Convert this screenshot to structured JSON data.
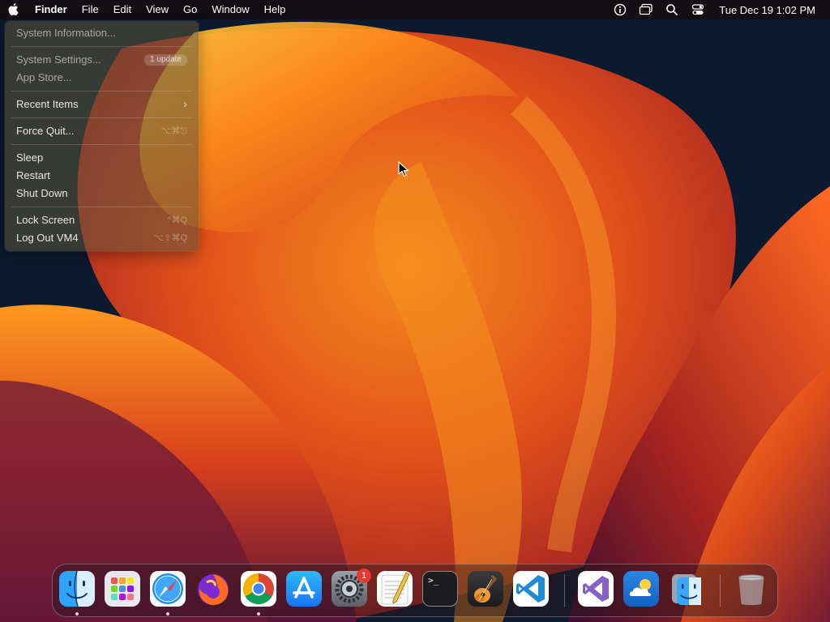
{
  "menubar": {
    "apple_icon": "apple-logo-icon",
    "app_name": "Finder",
    "menus": [
      "File",
      "Edit",
      "View",
      "Go",
      "Window",
      "Help"
    ],
    "status_icons": [
      "info-icon",
      "screen-mirroring-icon",
      "spotlight-search-icon",
      "control-center-icon"
    ],
    "clock": "Tue Dec 19  1:02 PM"
  },
  "apple_menu": {
    "system_information": "System Information...",
    "system_settings": "System Settings...",
    "system_settings_badge": "1 update",
    "app_store": "App Store...",
    "recent_items": "Recent Items",
    "recent_items_arrow": "›",
    "force_quit": "Force Quit...",
    "force_quit_shortcut": "⌥⌘⎋",
    "sleep": "Sleep",
    "restart": "Restart",
    "shut_down": "Shut Down",
    "lock_screen": "Lock Screen",
    "lock_screen_shortcut": "^⌘Q",
    "log_out": "Log Out VM4",
    "log_out_shortcut": "⌥⇧⌘Q"
  },
  "dock": {
    "apps": [
      {
        "name": "Finder",
        "icon": "finder-icon",
        "running": true
      },
      {
        "name": "Launchpad",
        "icon": "launchpad-icon",
        "running": false
      },
      {
        "name": "Safari",
        "icon": "safari-icon",
        "running": true
      },
      {
        "name": "Firefox",
        "icon": "firefox-icon",
        "running": false
      },
      {
        "name": "Google Chrome",
        "icon": "chrome-icon",
        "running": true
      },
      {
        "name": "App Store",
        "icon": "app-store-icon",
        "running": false
      },
      {
        "name": "System Settings",
        "icon": "system-settings-icon",
        "running": false,
        "badge": "1"
      },
      {
        "name": "TextEdit",
        "icon": "textedit-icon",
        "running": false
      },
      {
        "name": "Terminal",
        "icon": "terminal-icon",
        "running": false
      },
      {
        "name": "GarageBand",
        "icon": "garageband-icon",
        "running": false
      },
      {
        "name": "Visual Studio Code",
        "icon": "vscode-icon",
        "running": false
      },
      {
        "name": "Visual Studio",
        "icon": "visual-studio-icon",
        "running": false
      },
      {
        "name": "Weather",
        "icon": "weather-icon",
        "running": false
      },
      {
        "name": "Finder Folder",
        "icon": "finder-folder-icon",
        "running": false
      },
      {
        "name": "Trash",
        "icon": "trash-icon",
        "running": false
      }
    ],
    "terminal_prompt": ">_"
  },
  "colors": {
    "menubar_bg": "#140c0a",
    "menu_text": "#ffffff",
    "badge_red": "#e53935",
    "wallpaper_orange": "#f07a1a",
    "wallpaper_navy": "#0b1a2e"
  }
}
